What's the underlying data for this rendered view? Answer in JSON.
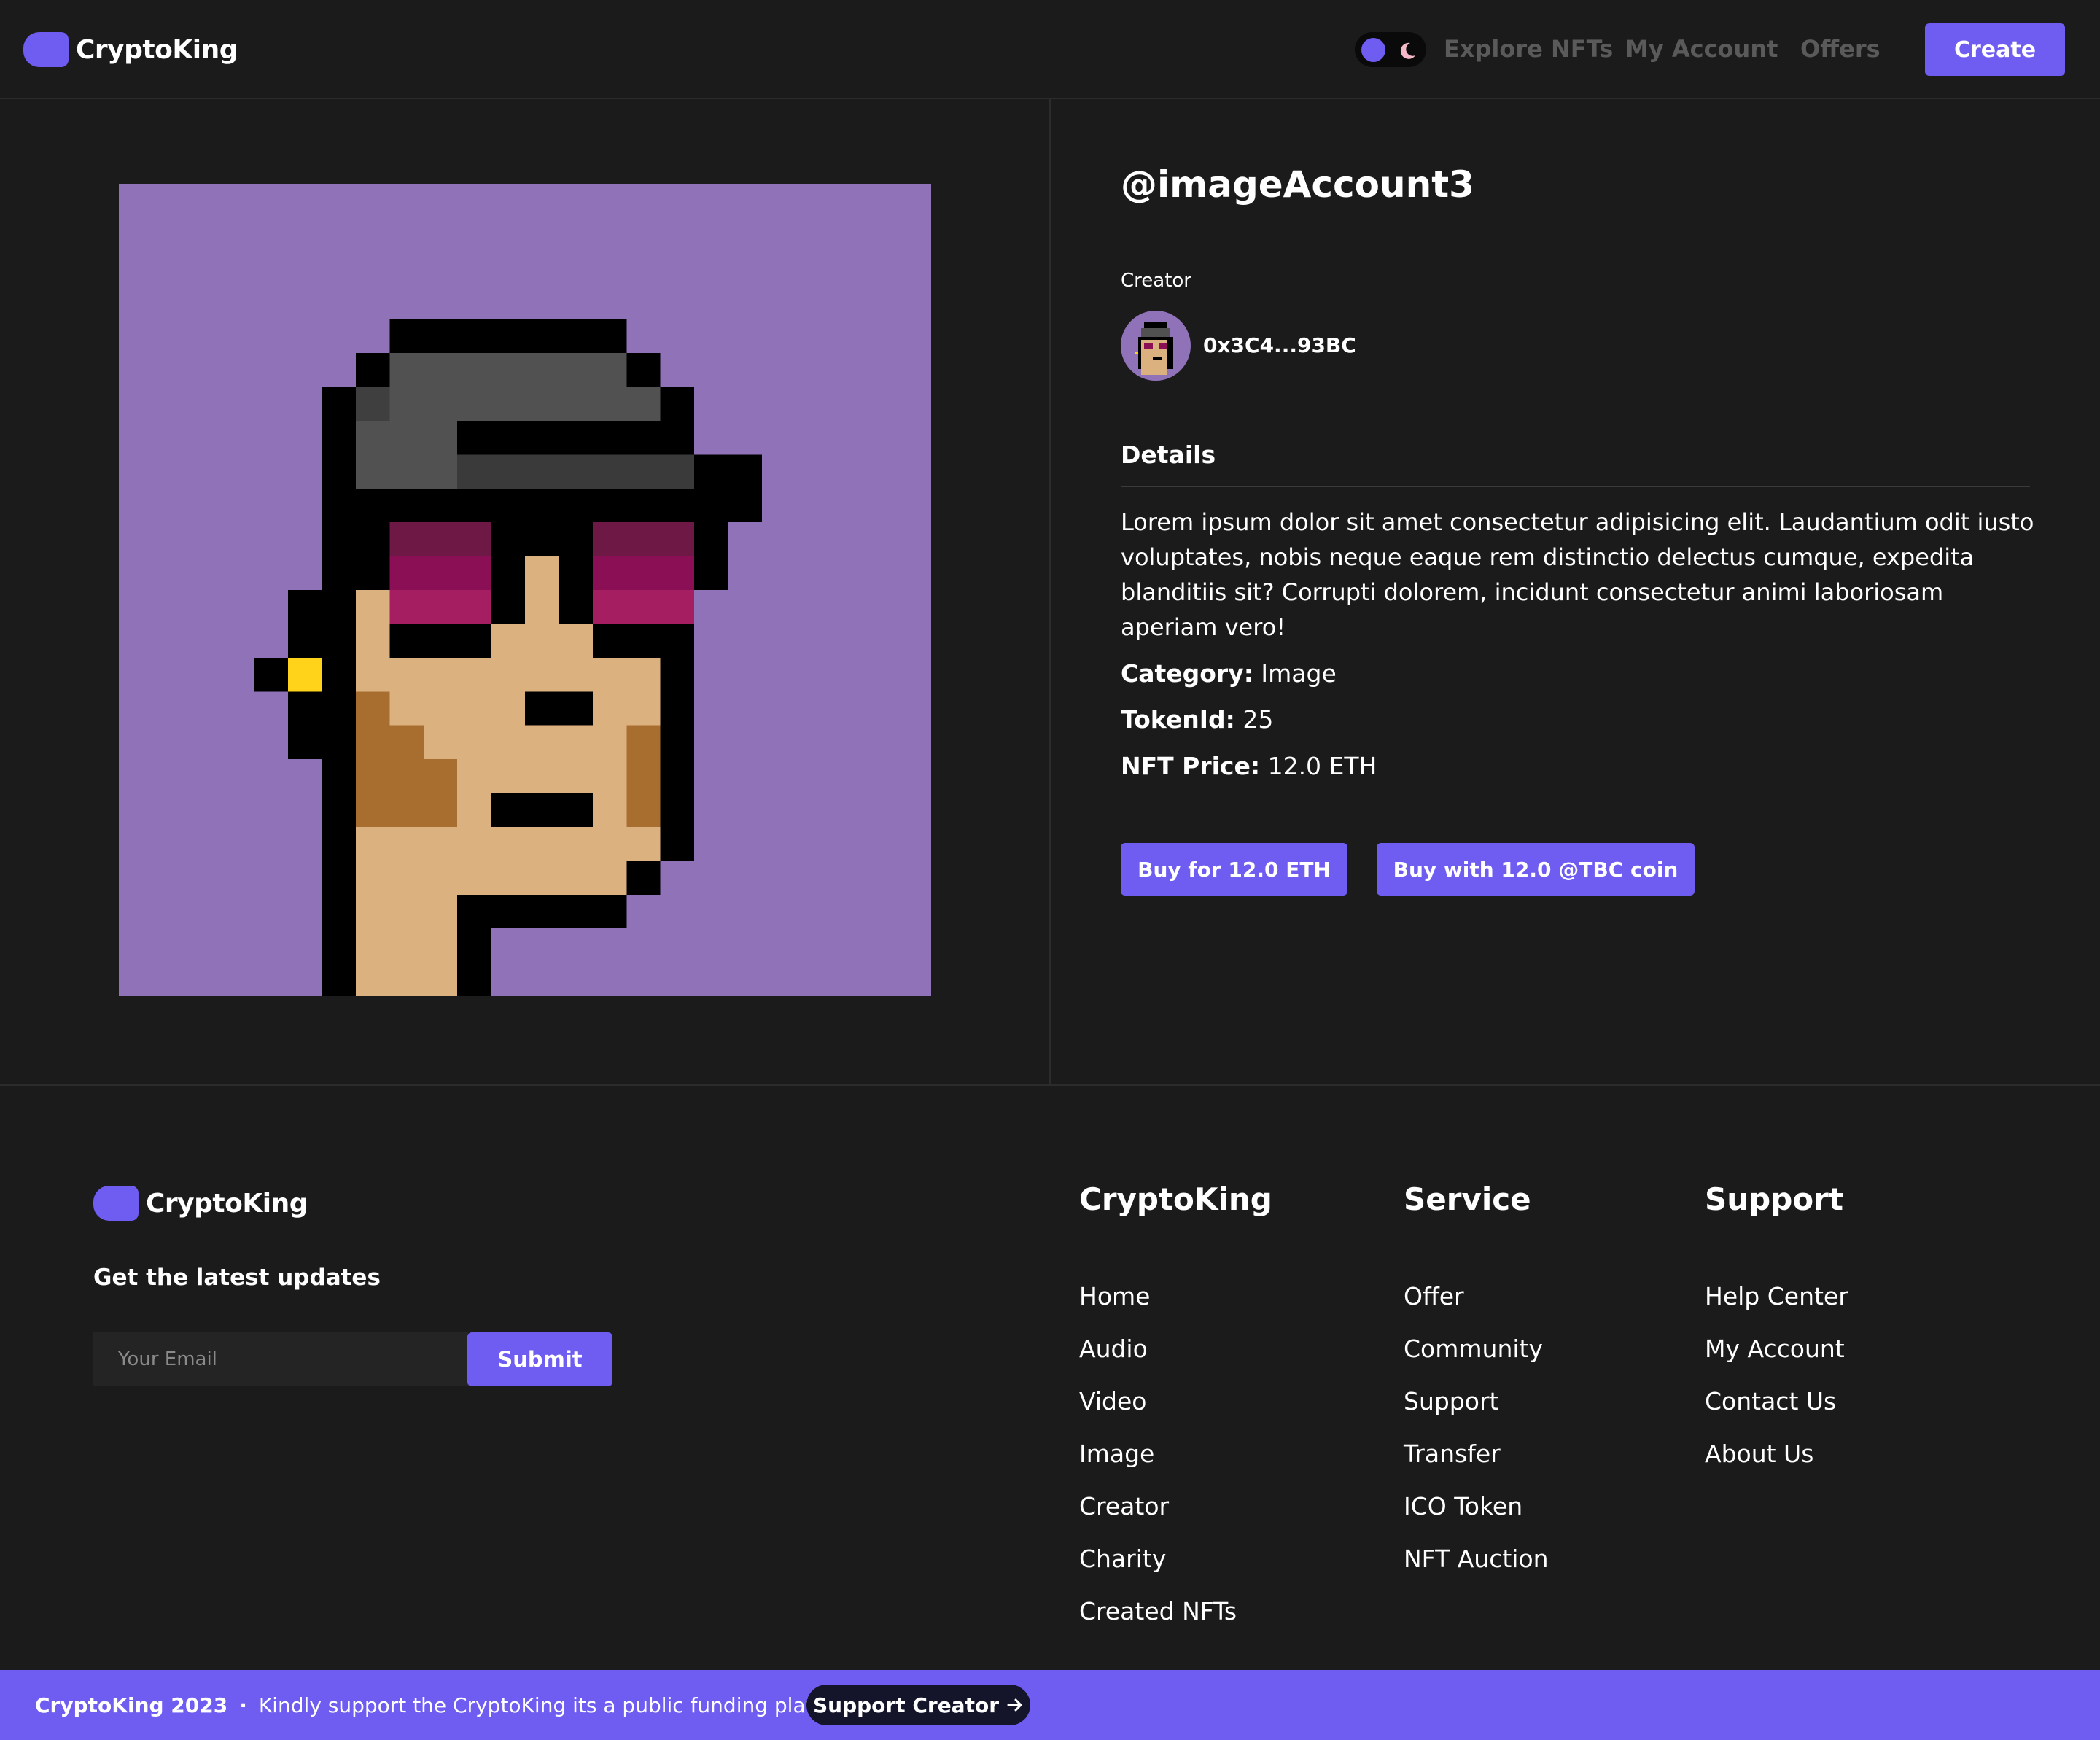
{
  "brand": {
    "name": "CryptoKing"
  },
  "nav": {
    "links": [
      "Explore NFTs",
      "My Account",
      "Offers"
    ],
    "create_label": "Create"
  },
  "nft": {
    "title": "@imageAccount3",
    "creator_label": "Creator",
    "creator_address": "0x3C4...93BC",
    "details_heading": "Details",
    "description": "Lorem ipsum dolor sit amet consectetur adipisicing elit. Laudantium odit iusto voluptates, nobis neque eaque rem distinctio delectus cumque, expedita blanditiis sit? Corrupti dolorem, incidunt consectetur animi laboriosam aperiam vero!",
    "category_label": "Category:",
    "category": "Image",
    "tokenid_label": "TokenId:",
    "tokenid": "25",
    "price_label": "NFT Price:",
    "price": "12.0 ETH",
    "buy_eth_label": "Buy for 12.0 ETH",
    "buy_coin_label": "Buy with 12.0 @TBC coin"
  },
  "footer": {
    "updates_label": "Get the latest updates",
    "email_placeholder": "Your Email",
    "submit_label": "Submit",
    "columns": [
      {
        "heading": "CryptoKing",
        "links": [
          "Home",
          "Audio",
          "Video",
          "Image",
          "Creator",
          "Charity",
          "Created NFTs"
        ]
      },
      {
        "heading": "Service",
        "links": [
          "Offer",
          "Community",
          "Support",
          "Transfer",
          "ICO Token",
          "NFT Auction"
        ]
      },
      {
        "heading": "Support",
        "links": [
          "Help Center",
          "My Account",
          "Contact Us",
          "About Us"
        ]
      }
    ]
  },
  "bottom_bar": {
    "copyright": "CryptoKing 2023",
    "separator": "·",
    "message": "Kindly support the CryptoKing its a public funding platform",
    "button_label": "Support Creator",
    "button_icon": "arrow-right-icon"
  },
  "colors": {
    "accent": "#6f5cf1",
    "background": "#1b1b1b",
    "nav_muted": "#5a5a5a",
    "nft_background": "#8f72b8"
  },
  "icons": [
    "theme-toggle-sun-icon",
    "moon-icon",
    "arrow-right-icon"
  ]
}
